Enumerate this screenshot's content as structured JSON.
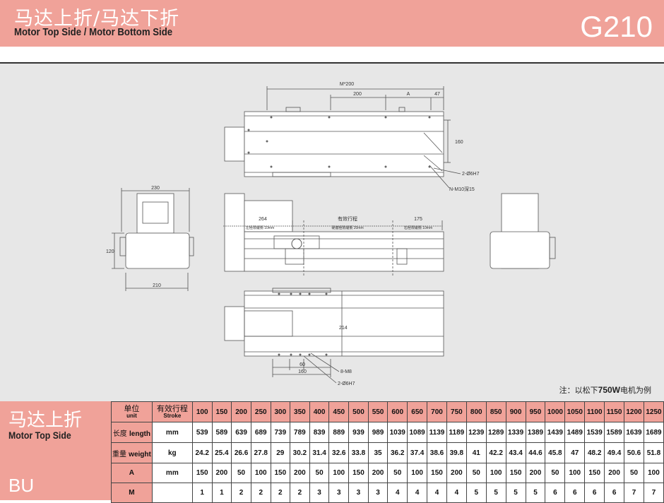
{
  "header": {
    "title_cn": "马达上折/马达下折",
    "title_en": "Motor Top Side / Motor Bottom Side",
    "model": "G210"
  },
  "drawing": {
    "dims": {
      "m200": "M*200",
      "d200": "200",
      "a": "A",
      "d47": "47",
      "d160": "160",
      "hole_2_6h7_top": "2-Ø6H7",
      "n_m10": "N-M10深15",
      "d230": "230",
      "d120": "120",
      "d210": "210",
      "d264": "264",
      "stroke": "有效行程",
      "d175": "175",
      "safety_left": "左極限緩衝 10mm",
      "safety_mid": "硬體極限緩衝 20mm",
      "safety_right": "右極限緩衝 10mm",
      "d214": "214",
      "d60": "60",
      "d160b": "160",
      "m8": "8-M8",
      "hole_2_6h7_bot": "2-Ø6H7"
    },
    "colors": {
      "line": "#555555",
      "bg": "#e7e7e7",
      "accent": "#f0a299"
    }
  },
  "note": {
    "prefix": "注：以松下",
    "power": "750W",
    "suffix": "电机为例"
  },
  "panel": {
    "cn": "马达上折",
    "en": "Motor Top Side",
    "code": "BU"
  },
  "table": {
    "unit_cn": "单位",
    "unit_en": "unit",
    "stroke_cn": "有效行程",
    "stroke_en": "Stroke",
    "strokes": [
      "100",
      "150",
      "200",
      "250",
      "300",
      "350",
      "400",
      "450",
      "500",
      "550",
      "600",
      "650",
      "700",
      "750",
      "800",
      "850",
      "900",
      "950",
      "1000",
      "1050",
      "1100",
      "1150",
      "1200",
      "1250"
    ],
    "rows": [
      {
        "label_cn": "长度",
        "label_en": "length",
        "unit": "mm",
        "values": [
          "539",
          "589",
          "639",
          "689",
          "739",
          "789",
          "839",
          "889",
          "939",
          "989",
          "1039",
          "1089",
          "1139",
          "1189",
          "1239",
          "1289",
          "1339",
          "1389",
          "1439",
          "1489",
          "1539",
          "1589",
          "1639",
          "1689"
        ]
      },
      {
        "label_cn": "重量",
        "label_en": "weight",
        "unit": "kg",
        "values": [
          "24.2",
          "25.4",
          "26.6",
          "27.8",
          "29",
          "30.2",
          "31.4",
          "32.6",
          "33.8",
          "35",
          "36.2",
          "37.4",
          "38.6",
          "39.8",
          "41",
          "42.2",
          "43.4",
          "44.6",
          "45.8",
          "47",
          "48.2",
          "49.4",
          "50.6",
          "51.8"
        ]
      },
      {
        "label_cn": "",
        "label_en": "A",
        "unit": "mm",
        "values": [
          "150",
          "200",
          "50",
          "100",
          "150",
          "200",
          "50",
          "100",
          "150",
          "200",
          "50",
          "100",
          "150",
          "200",
          "50",
          "100",
          "150",
          "200",
          "50",
          "100",
          "150",
          "200",
          "50",
          "100"
        ]
      },
      {
        "label_cn": "",
        "label_en": "M",
        "unit": "",
        "values": [
          "1",
          "1",
          "2",
          "2",
          "2",
          "2",
          "3",
          "3",
          "3",
          "3",
          "4",
          "4",
          "4",
          "4",
          "5",
          "5",
          "5",
          "5",
          "6",
          "6",
          "6",
          "6",
          "7",
          "7"
        ]
      }
    ]
  }
}
